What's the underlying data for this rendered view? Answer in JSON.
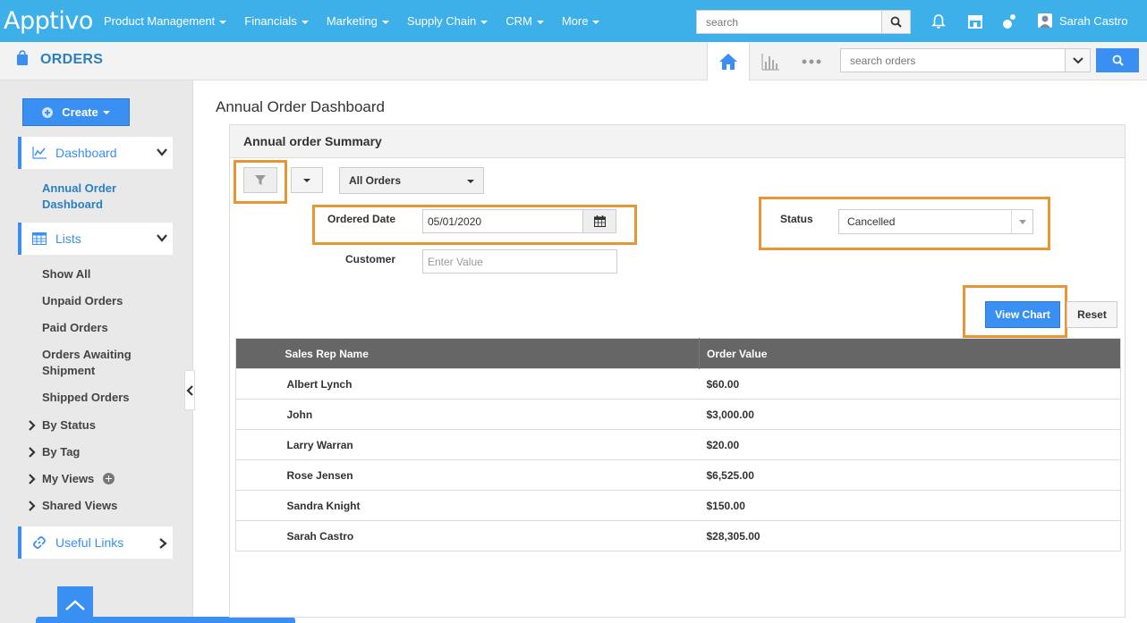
{
  "topnav": {
    "logo": "Apptivo",
    "menu": [
      "Product Management",
      "Financials",
      "Marketing",
      "Supply Chain",
      "CRM",
      "More"
    ],
    "search_placeholder": "search",
    "user_name": "Sarah Castro",
    "bg_color": "#3db0ea"
  },
  "subheader": {
    "app_title": "ORDERS",
    "search_placeholder": "search orders"
  },
  "sidebar": {
    "create_label": "Create",
    "dashboard_label": "Dashboard",
    "dashboard_items": [
      "Annual Order Dashboard"
    ],
    "lists_label": "Lists",
    "list_items": [
      "Show All",
      "Unpaid Orders",
      "Paid Orders",
      "Orders Awaiting Shipment",
      "Shipped Orders"
    ],
    "expandables": [
      "By Status",
      "By Tag",
      "My Views",
      "Shared Views"
    ],
    "useful_links_label": "Useful Links"
  },
  "main": {
    "page_title": "Annual Order Dashboard",
    "panel_title": "Annual order Summary",
    "view_select": "All Orders",
    "ordered_date_label": "Ordered Date",
    "ordered_date_value": "05/01/2020",
    "status_label": "Status",
    "status_value": "Cancelled",
    "customer_label": "Customer",
    "customer_placeholder": "Enter Value",
    "view_chart_label": "View Chart",
    "reset_label": "Reset",
    "table": {
      "headers": [
        "Sales Rep Name",
        "Order Value"
      ],
      "rows": [
        [
          "Albert Lynch",
          "$60.00"
        ],
        [
          "John",
          "$3,000.00"
        ],
        [
          "Larry Warran",
          "$20.00"
        ],
        [
          "Rose Jensen",
          "$6,525.00"
        ],
        [
          "Sandra Knight",
          "$150.00"
        ],
        [
          "Sarah Castro",
          "$28,305.00"
        ]
      ]
    }
  },
  "colors": {
    "accent": "#3a8ff3",
    "highlight": "#e89533",
    "table_header": "#666666"
  }
}
